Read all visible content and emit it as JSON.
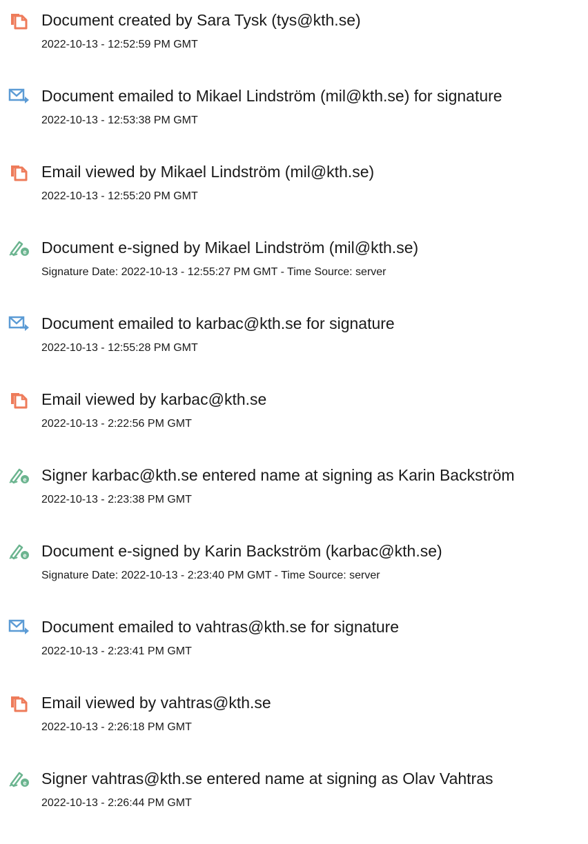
{
  "entries": [
    {
      "icon": "document-created-icon",
      "title": "Document created by Sara Tysk (tys@kth.se)",
      "detail": "2022-10-13 - 12:52:59 PM GMT"
    },
    {
      "icon": "email-sent-icon",
      "title": "Document emailed to Mikael Lindström (mil@kth.se) for signature",
      "detail": "2022-10-13 - 12:53:38 PM GMT"
    },
    {
      "icon": "document-viewed-icon",
      "title": "Email viewed by Mikael Lindström (mil@kth.se)",
      "detail": "2022-10-13 - 12:55:20 PM GMT"
    },
    {
      "icon": "e-sign-icon",
      "title": "Document e-signed by Mikael Lindström (mil@kth.se)",
      "detail": "Signature Date: 2022-10-13 - 12:55:27 PM GMT - Time Source: server"
    },
    {
      "icon": "email-sent-icon",
      "title": "Document emailed to karbac@kth.se for signature",
      "detail": "2022-10-13 - 12:55:28 PM GMT"
    },
    {
      "icon": "document-viewed-icon",
      "title": "Email viewed by karbac@kth.se",
      "detail": "2022-10-13 - 2:22:56 PM GMT"
    },
    {
      "icon": "e-sign-icon",
      "title": "Signer karbac@kth.se entered name at signing as Karin Backström",
      "detail": "2022-10-13 - 2:23:38 PM GMT"
    },
    {
      "icon": "e-sign-icon",
      "title": "Document e-signed by Karin Backström (karbac@kth.se)",
      "detail": "Signature Date: 2022-10-13 - 2:23:40 PM GMT - Time Source: server"
    },
    {
      "icon": "email-sent-icon",
      "title": "Document emailed to vahtras@kth.se for signature",
      "detail": "2022-10-13 - 2:23:41 PM GMT"
    },
    {
      "icon": "document-viewed-icon",
      "title": "Email viewed by vahtras@kth.se",
      "detail": "2022-10-13 - 2:26:18 PM GMT"
    },
    {
      "icon": "e-sign-icon",
      "title": "Signer vahtras@kth.se entered name at signing as Olav Vahtras",
      "detail": "2022-10-13 - 2:26:44 PM GMT"
    }
  ],
  "colors": {
    "document_icon": "#ee7b5a",
    "email_icon": "#5b9bd5",
    "sign_icon": "#6bb48f",
    "text": "#1a1a1a"
  }
}
